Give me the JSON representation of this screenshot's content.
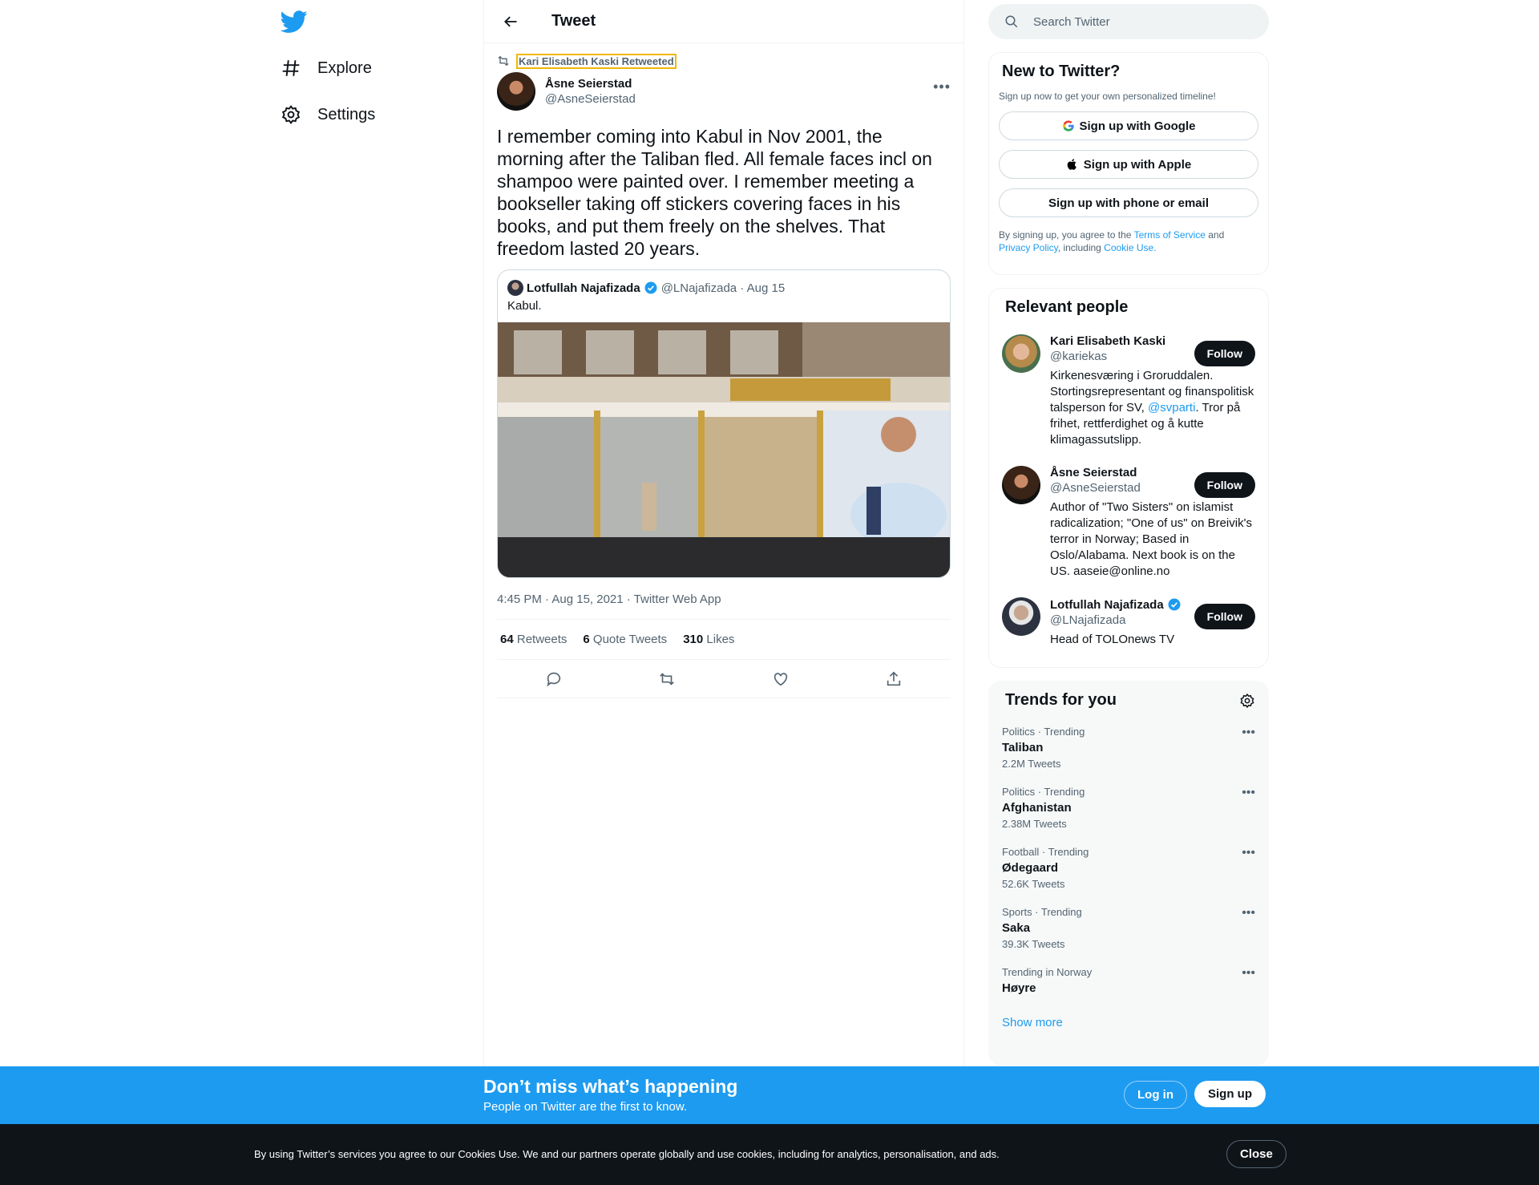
{
  "nav": {
    "explore_label": "Explore",
    "settings_label": "Settings"
  },
  "header": {
    "title": "Tweet"
  },
  "tweet": {
    "retweeted_by": "Kari Elisabeth Kaski Retweeted",
    "author_name": "Åsne Seierstad",
    "author_handle": "@AsneSeierstad",
    "text": "I remember coming into Kabul in Nov 2001, the morning after the Taliban fled. All female faces incl on shampoo were painted over. I remember meeting a bookseller taking off stickers covering faces in his books, and put them freely on the shelves. That freedom lasted 20 years.",
    "quote": {
      "name": "Lotfullah Najafizada",
      "meta": "@LNajafizada · Aug 15",
      "text": "Kabul."
    },
    "timestamp": "4:45 PM · Aug 15, 2021 · Twitter Web App",
    "stats": {
      "retweets_count": "64",
      "retweets_label": "Retweets",
      "quotes_count": "6",
      "quotes_label": "Quote Tweets",
      "likes_count": "310",
      "likes_label": "Likes"
    }
  },
  "search": {
    "placeholder": "Search Twitter"
  },
  "new_to_twitter": {
    "title": "New to Twitter?",
    "subtitle": "Sign up now to get your own personalized timeline!",
    "google_label": "Sign up with Google",
    "apple_label": "Sign up with Apple",
    "phone_label": "Sign up with phone or email",
    "legal_pre": "By signing up, you agree to the ",
    "terms": "Terms of Service",
    "legal_and": " and ",
    "privacy": "Privacy Policy",
    "legal_including": ", including ",
    "cookie": "Cookie Use."
  },
  "relevant_people": {
    "title": "Relevant people",
    "follow_label": "Follow",
    "people": [
      {
        "name": "Kari Elisabeth Kaski",
        "handle": "@kariekas",
        "bio_pre": "Kirkenesværing i Groruddalen. Stortingsrepresentant og finanspolitisk talsperson for SV, ",
        "bio_mention": "@svparti",
        "bio_post": ". Tror på frihet, rettferdighet og å kutte klimagassutslipp."
      },
      {
        "name": "Åsne Seierstad",
        "handle": "@AsneSeierstad",
        "bio": "Author of \"Two Sisters\" on islamist radicalization; \"One of us\" on Breivik's terror in Norway; Based in Oslo/Alabama. Next book is on the US. aaseie@online.no"
      },
      {
        "name": "Lotfullah Najafizada",
        "handle": "@LNajafizada",
        "bio": "Head of TOLOnews TV"
      }
    ]
  },
  "trends": {
    "title": "Trends for you",
    "items": [
      {
        "meta": "Politics · Trending",
        "name": "Taliban",
        "count": "2.2M Tweets"
      },
      {
        "meta": "Politics · Trending",
        "name": "Afghanistan",
        "count": "2.38M Tweets"
      },
      {
        "meta": "Football · Trending",
        "name": "Ødegaard",
        "count": "52.6K Tweets"
      },
      {
        "meta": "Sports · Trending",
        "name": "Saka",
        "count": "39.3K Tweets"
      },
      {
        "meta": "Trending in Norway",
        "name": "Høyre",
        "count": ""
      }
    ],
    "show_more": "Show more"
  },
  "banner": {
    "title": "Don’t miss what’s happening",
    "subtitle": "People on Twitter are the first to know.",
    "login": "Log in",
    "signup": "Sign up"
  },
  "cookie_bar": {
    "text": "By using Twitter’s services you agree to our Cookies Use. We and our partners operate globally and use cookies, including for analytics, personalisation, and ads.",
    "close": "Close"
  },
  "colors": {
    "accent": "#1d9bf0",
    "text": "#0f1419",
    "muted": "#536471"
  }
}
